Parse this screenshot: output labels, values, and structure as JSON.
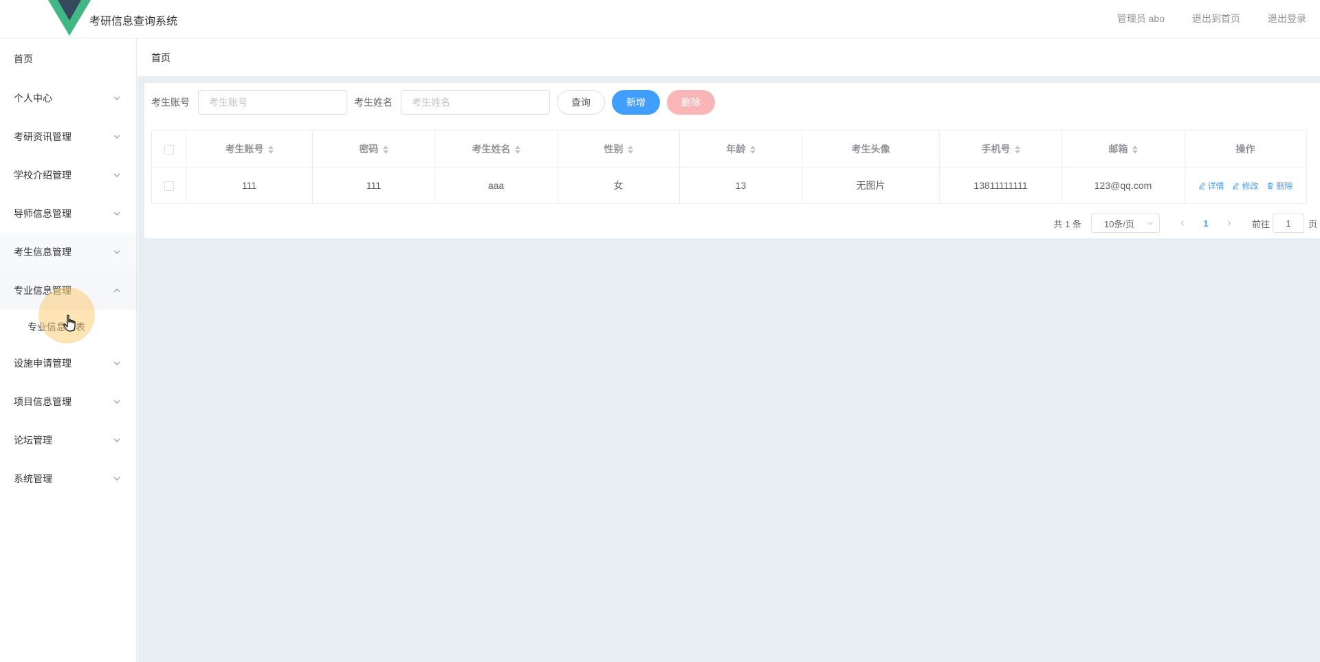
{
  "header": {
    "title": "考研信息查询系统",
    "links": [
      "管理员 abo",
      "退出到首页",
      "退出登录"
    ],
    "logo_colors": {
      "outer": "#41b883",
      "inner": "#35495e"
    }
  },
  "sidebar": {
    "items": [
      {
        "label": "首页",
        "has_children": false
      },
      {
        "label": "个人中心",
        "has_children": true
      },
      {
        "label": "考研资讯管理",
        "has_children": true
      },
      {
        "label": "学校介绍管理",
        "has_children": true
      },
      {
        "label": "导师信息管理",
        "has_children": true
      },
      {
        "label": "考生信息管理",
        "has_children": true
      },
      {
        "label": "专业信息管理",
        "has_children": true,
        "open": true,
        "children": [
          "专业信息列表"
        ]
      },
      {
        "label": "设施申请管理",
        "has_children": true
      },
      {
        "label": "项目信息管理",
        "has_children": true
      },
      {
        "label": "论坛管理",
        "has_children": true
      },
      {
        "label": "系统管理",
        "has_children": true
      }
    ]
  },
  "breadcrumb": {
    "current": "首页"
  },
  "search": {
    "account_label": "考生账号",
    "account_placeholder": "考生账号",
    "account_value": "",
    "name_label": "考生姓名",
    "name_placeholder": "考生姓名",
    "name_value": "",
    "query_button": "查询",
    "add_button": "新增",
    "delete_button": "删除"
  },
  "table": {
    "columns": [
      "考生账号",
      "密码",
      "考生姓名",
      "性别",
      "年龄",
      "考生头像",
      "手机号",
      "邮箱",
      "操作"
    ],
    "rows": [
      {
        "account": "111",
        "password": "111",
        "name": "aaa",
        "gender": "女",
        "age": "13",
        "avatar": "无图片",
        "phone": "13811111111",
        "email": "123@qq.com"
      }
    ],
    "actions": [
      "详情",
      "修改",
      "删除"
    ]
  },
  "pagination": {
    "total": "共 1 条",
    "page_size": "10条/页",
    "current_page": "1",
    "jump_label": "前往",
    "jump_value": "1",
    "page_suffix": "页"
  },
  "colors": {
    "primary": "#409eff",
    "danger_disabled": "#fab6b6",
    "main_bg": "#e9eef3"
  }
}
